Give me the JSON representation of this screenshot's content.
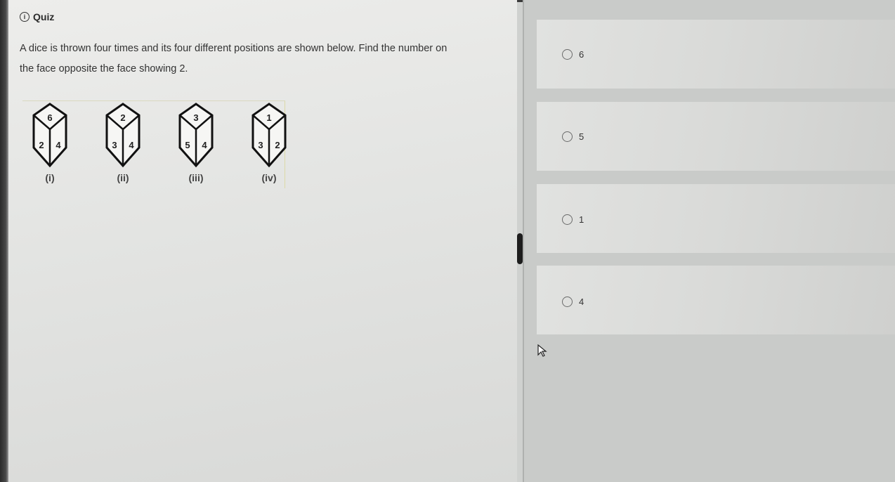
{
  "quiz": {
    "icon": "info-circle-icon",
    "icon_glyph": "i",
    "title": "Quiz"
  },
  "question": {
    "line1": "A dice is thrown four times and its four different positions are shown below. Find the number on",
    "line2": "the face opposite the face showing 2."
  },
  "dice": [
    {
      "top": "6",
      "left": "2",
      "right": "4",
      "label": "(i)"
    },
    {
      "top": "2",
      "left": "3",
      "right": "4",
      "label": "(ii)"
    },
    {
      "top": "3",
      "left": "5",
      "right": "4",
      "label": "(iii)"
    },
    {
      "top": "1",
      "left": "3",
      "right": "2",
      "label": "(iv)"
    }
  ],
  "options": [
    {
      "label": "6"
    },
    {
      "label": "5"
    },
    {
      "label": "1"
    },
    {
      "label": "4"
    }
  ]
}
